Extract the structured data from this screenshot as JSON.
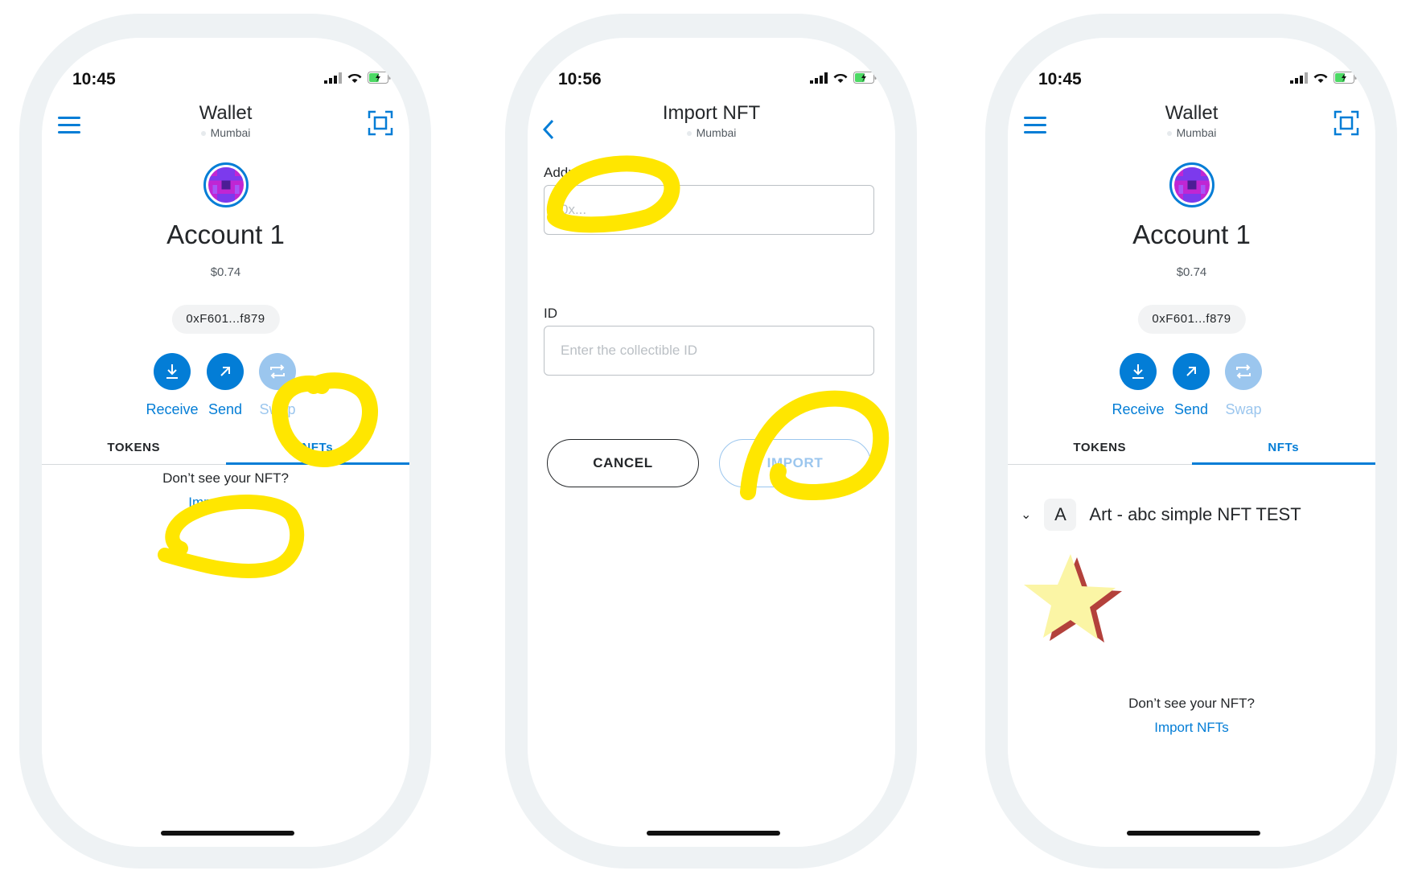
{
  "status_bar": [
    {
      "time": "10:45"
    },
    {
      "time": "10:56"
    },
    {
      "time": "10:45"
    }
  ],
  "wallet": {
    "title": "Wallet",
    "network": "Mumbai",
    "account_name": "Account 1",
    "balance": "$0.74",
    "address": "0xF601...f879",
    "actions": {
      "receive": "Receive",
      "send": "Send",
      "swap": "Swap"
    },
    "tabs": {
      "tokens": "TOKENS",
      "nfts": "NFTs"
    },
    "empty_text": "Don’t see your NFT?",
    "import_link": "Import NFTs",
    "collection": {
      "letter": "A",
      "name": "Art - abc simple NFT TEST"
    }
  },
  "import": {
    "title": "Import NFT",
    "network": "Mumbai",
    "address_label": "Address",
    "address_placeholder": "0x...",
    "id_label": "ID",
    "id_placeholder": "Enter the collectible ID",
    "cancel_label": "CANCEL",
    "import_label": "IMPORT"
  },
  "colors": {
    "accent": "#037dd6",
    "accent_disabled": "#9bc6ee",
    "highlight": "#ffe600"
  },
  "icons": [
    "hamburger-icon",
    "scan-icon",
    "back-chevron-icon",
    "receive-icon",
    "send-icon",
    "swap-icon",
    "signal-icon",
    "wifi-icon",
    "battery-icon",
    "star-nft-image"
  ]
}
